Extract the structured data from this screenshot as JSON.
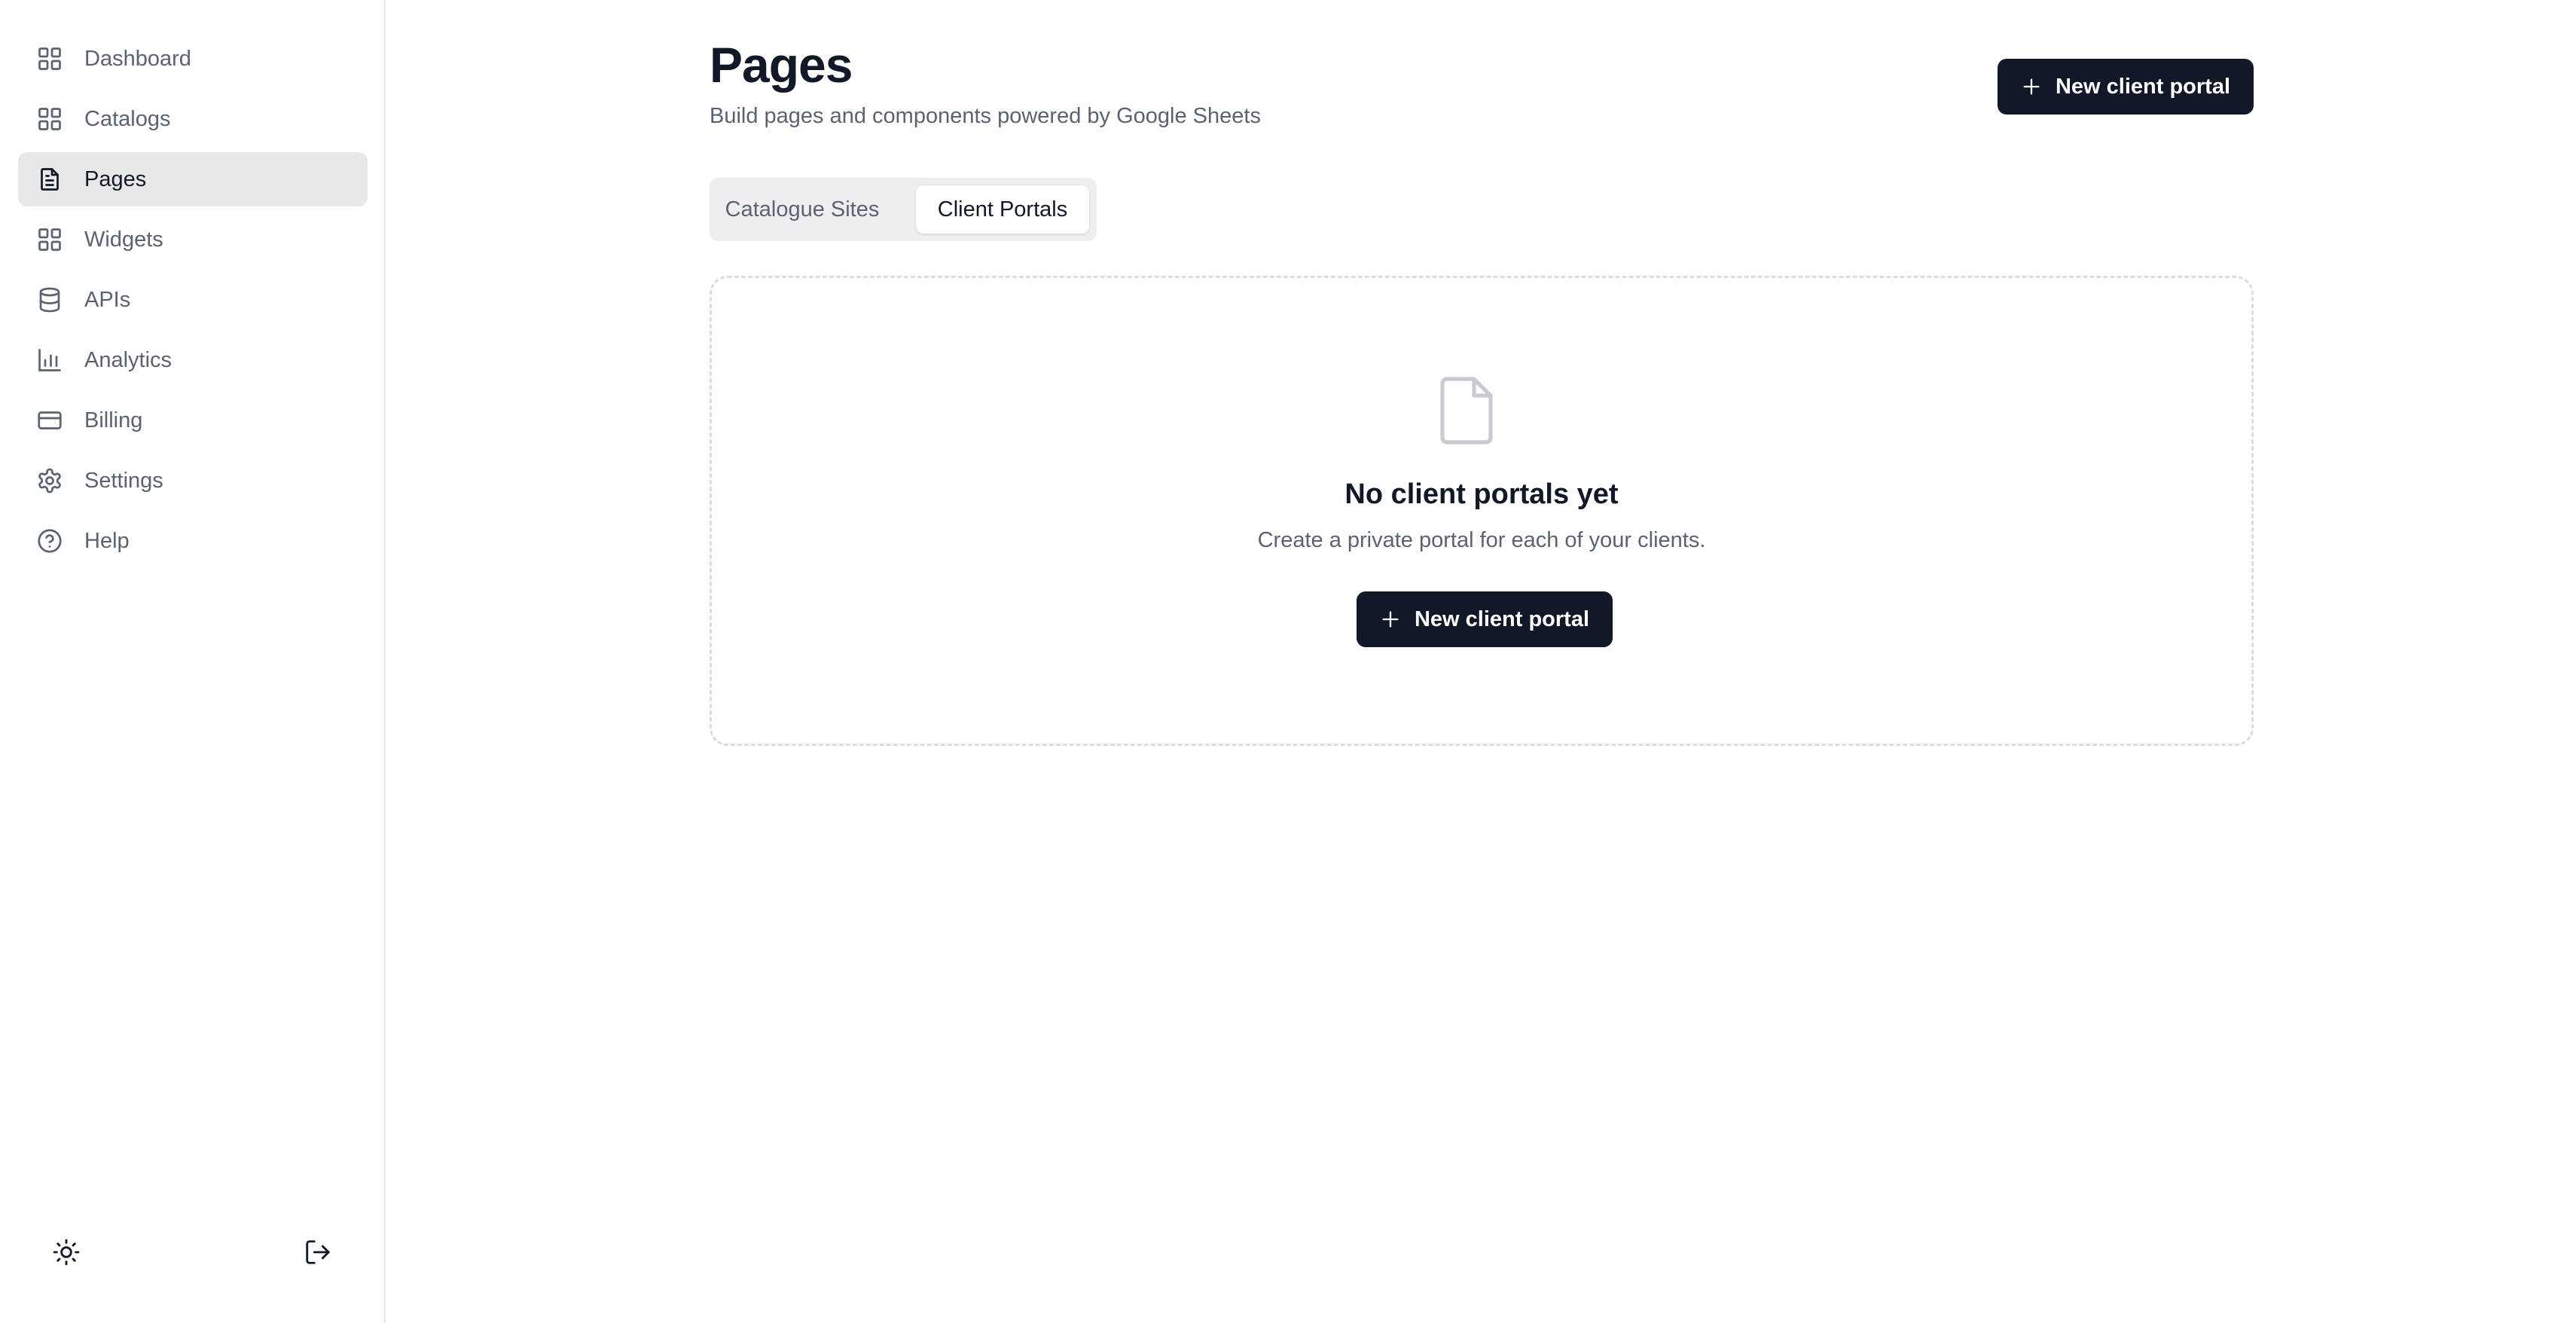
{
  "sidebar": {
    "items": [
      {
        "label": "Dashboard",
        "icon": "layout-grid-icon",
        "active": false
      },
      {
        "label": "Catalogs",
        "icon": "layout-grid-icon",
        "active": false
      },
      {
        "label": "Pages",
        "icon": "file-text-icon",
        "active": true
      },
      {
        "label": "Widgets",
        "icon": "layout-grid-icon",
        "active": false
      },
      {
        "label": "APIs",
        "icon": "database-icon",
        "active": false
      },
      {
        "label": "Analytics",
        "icon": "bar-chart-icon",
        "active": false
      },
      {
        "label": "Billing",
        "icon": "credit-card-icon",
        "active": false
      },
      {
        "label": "Settings",
        "icon": "gear-icon",
        "active": false
      },
      {
        "label": "Help",
        "icon": "help-circle-icon",
        "active": false
      }
    ],
    "footer": {
      "theme_icon": "sun-icon",
      "logout_icon": "log-out-icon"
    }
  },
  "header": {
    "title": "Pages",
    "subtitle": "Build pages and components powered by Google Sheets",
    "primary_button": "New client portal"
  },
  "tabs": [
    {
      "label": "Catalogue Sites",
      "selected": false
    },
    {
      "label": "Client Portals",
      "selected": true
    }
  ],
  "empty_state": {
    "icon": "file-icon",
    "title": "No client portals yet",
    "description": "Create a private portal for each of your clients.",
    "button": "New client portal"
  },
  "colors": {
    "primary": "#111827",
    "muted_text": "#5b6270",
    "active_nav_bg": "#e8e8e8",
    "border": "#e7e8ea"
  }
}
